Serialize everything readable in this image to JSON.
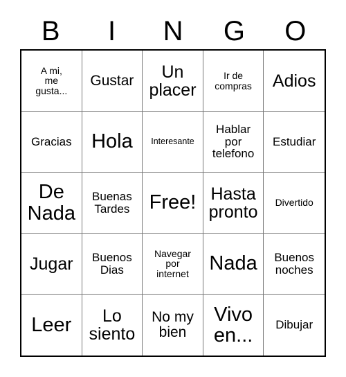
{
  "card": {
    "title": "BINGO",
    "headers": [
      "B",
      "I",
      "N",
      "G",
      "O"
    ],
    "free_space_label": "Free!",
    "colors": {
      "text": "#000000",
      "background": "#ffffff",
      "outer_border": "#000000",
      "grid_line": "#777777"
    },
    "rows": [
      [
        {
          "text": "A mi,\nme\ngusta...",
          "size": "fs-xs"
        },
        {
          "text": "Gustar",
          "size": "fs-md"
        },
        {
          "text": "Un\nplacer",
          "size": "fs-lg"
        },
        {
          "text": "Ir de\ncompras",
          "size": "fs-xs"
        },
        {
          "text": "Adios",
          "size": "fs-lg"
        }
      ],
      [
        {
          "text": "Gracias",
          "size": "fs-sm"
        },
        {
          "text": "Hola",
          "size": "fs-xl"
        },
        {
          "text": "Interesante",
          "size": "fs-xxs"
        },
        {
          "text": "Hablar\npor\ntelefono",
          "size": "fs-sm"
        },
        {
          "text": "Estudiar",
          "size": "fs-sm"
        }
      ],
      [
        {
          "text": "De\nNada",
          "size": "fs-xl"
        },
        {
          "text": "Buenas\nTardes",
          "size": "fs-sm"
        },
        {
          "text": "Free!",
          "size": "fs-xl"
        },
        {
          "text": "Hasta\npronto",
          "size": "fs-lg"
        },
        {
          "text": "Divertido",
          "size": "fs-xs"
        }
      ],
      [
        {
          "text": "Jugar",
          "size": "fs-lg"
        },
        {
          "text": "Buenos\nDias",
          "size": "fs-sm"
        },
        {
          "text": "Navegar\npor\ninternet",
          "size": "fs-xs"
        },
        {
          "text": "Nada",
          "size": "fs-xl"
        },
        {
          "text": "Buenos\nnoches",
          "size": "fs-sm"
        }
      ],
      [
        {
          "text": "Leer",
          "size": "fs-xl"
        },
        {
          "text": "Lo\nsiento",
          "size": "fs-lg"
        },
        {
          "text": "No my\nbien",
          "size": "fs-md"
        },
        {
          "text": "Vivo\nen...",
          "size": "fs-xl"
        },
        {
          "text": "Dibujar",
          "size": "fs-sm"
        }
      ]
    ]
  }
}
